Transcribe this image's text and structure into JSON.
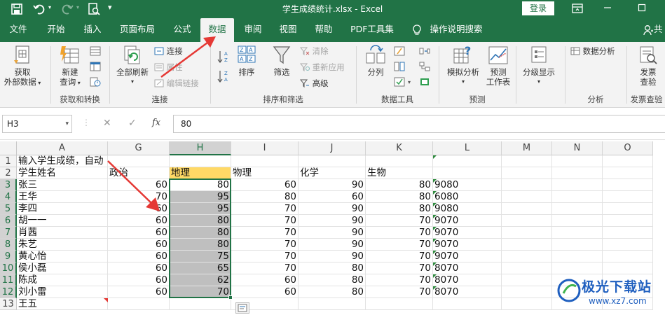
{
  "window": {
    "title": "学生成绩统计.xlsx - Excel",
    "login_label": "登录",
    "share_label": "共"
  },
  "tabs": [
    "文件",
    "开始",
    "插入",
    "页面布局",
    "公式",
    "数据",
    "审阅",
    "视图",
    "帮助",
    "PDF工具集",
    "操作说明搜索"
  ],
  "active_tab": "数据",
  "ribbon": {
    "get_external": [
      "获取",
      "外部数据"
    ],
    "new_query": [
      "新建",
      "查询"
    ],
    "group_get_transform": "获取和转换",
    "refresh_all": "全部刷新",
    "connections": "连接",
    "properties": "属性",
    "edit_links": "编辑链接",
    "group_connections": "连接",
    "sort_az": "A↓Z",
    "sort": "排序",
    "filter": "筛选",
    "clear": "清除",
    "reapply": "重新应用",
    "advanced": "高级",
    "group_sort_filter": "排序和筛选",
    "text_to_columns": "分列",
    "group_data_tools": "数据工具",
    "what_if": "模拟分析",
    "forecast_sheet": [
      "预测",
      "工作表"
    ],
    "group_forecast": "预测",
    "outline": "分级显示",
    "data_analysis": "数据分析",
    "group_analysis": "分析",
    "invoice_check": [
      "发票",
      "查验"
    ],
    "group_invoice": "发票查验"
  },
  "formula_bar": {
    "name_box": "H3",
    "cancel_icon": "✕",
    "enter_icon": "✓",
    "fx_label": "fx",
    "formula": "80"
  },
  "sheet": {
    "columns": [
      "A",
      "G",
      "H",
      "I",
      "J",
      "K",
      "L",
      "M",
      "N",
      "O"
    ],
    "selected_column": "H",
    "row_numbers": [
      "1",
      "2",
      "3",
      "4",
      "5",
      "6",
      "7",
      "8",
      "9",
      "10",
      "11",
      "12",
      "13"
    ],
    "row1_text": "输入学生成绩，自动",
    "headers": [
      "学生姓名",
      "政治",
      "地理",
      "物理",
      "化学",
      "生物"
    ],
    "rows": [
      {
        "name": "张三",
        "g": "60",
        "h": "80",
        "i": "60",
        "j": "90",
        "k": "80",
        "l": "9080"
      },
      {
        "name": "王华",
        "g": "70",
        "h": "95",
        "i": "80",
        "j": "60",
        "k": "80",
        "l": "6080"
      },
      {
        "name": "李四",
        "g": "60",
        "h": "95",
        "i": "70",
        "j": "90",
        "k": "80",
        "l": "9080"
      },
      {
        "name": "胡一一",
        "g": "60",
        "h": "80",
        "i": "70",
        "j": "90",
        "k": "70",
        "l": "9070"
      },
      {
        "name": "肖茜",
        "g": "60",
        "h": "80",
        "i": "70",
        "j": "90",
        "k": "70",
        "l": "9070"
      },
      {
        "name": "朱艺",
        "g": "60",
        "h": "80",
        "i": "70",
        "j": "90",
        "k": "70",
        "l": "9070"
      },
      {
        "name": "黄心怡",
        "g": "60",
        "h": "75",
        "i": "70",
        "j": "90",
        "k": "70",
        "l": "9070"
      },
      {
        "name": "侯小磊",
        "g": "60",
        "h": "65",
        "i": "70",
        "j": "80",
        "k": "70",
        "l": "8070"
      },
      {
        "name": "陈成",
        "g": "60",
        "h": "62",
        "i": "60",
        "j": "80",
        "k": "70",
        "l": "8070"
      },
      {
        "name": "刘小雷",
        "g": "60",
        "h": "70",
        "i": "60",
        "j": "80",
        "k": "70",
        "l": "8070"
      }
    ],
    "row13_name": "王五"
  },
  "watermark": {
    "text": "极光下载站",
    "url": "www.xz7.com"
  },
  "colors": {
    "excel_green": "#217346",
    "header_yellow": "#ffd966",
    "selection_gray": "#bfbfbf",
    "arrow_red": "#e53935"
  }
}
